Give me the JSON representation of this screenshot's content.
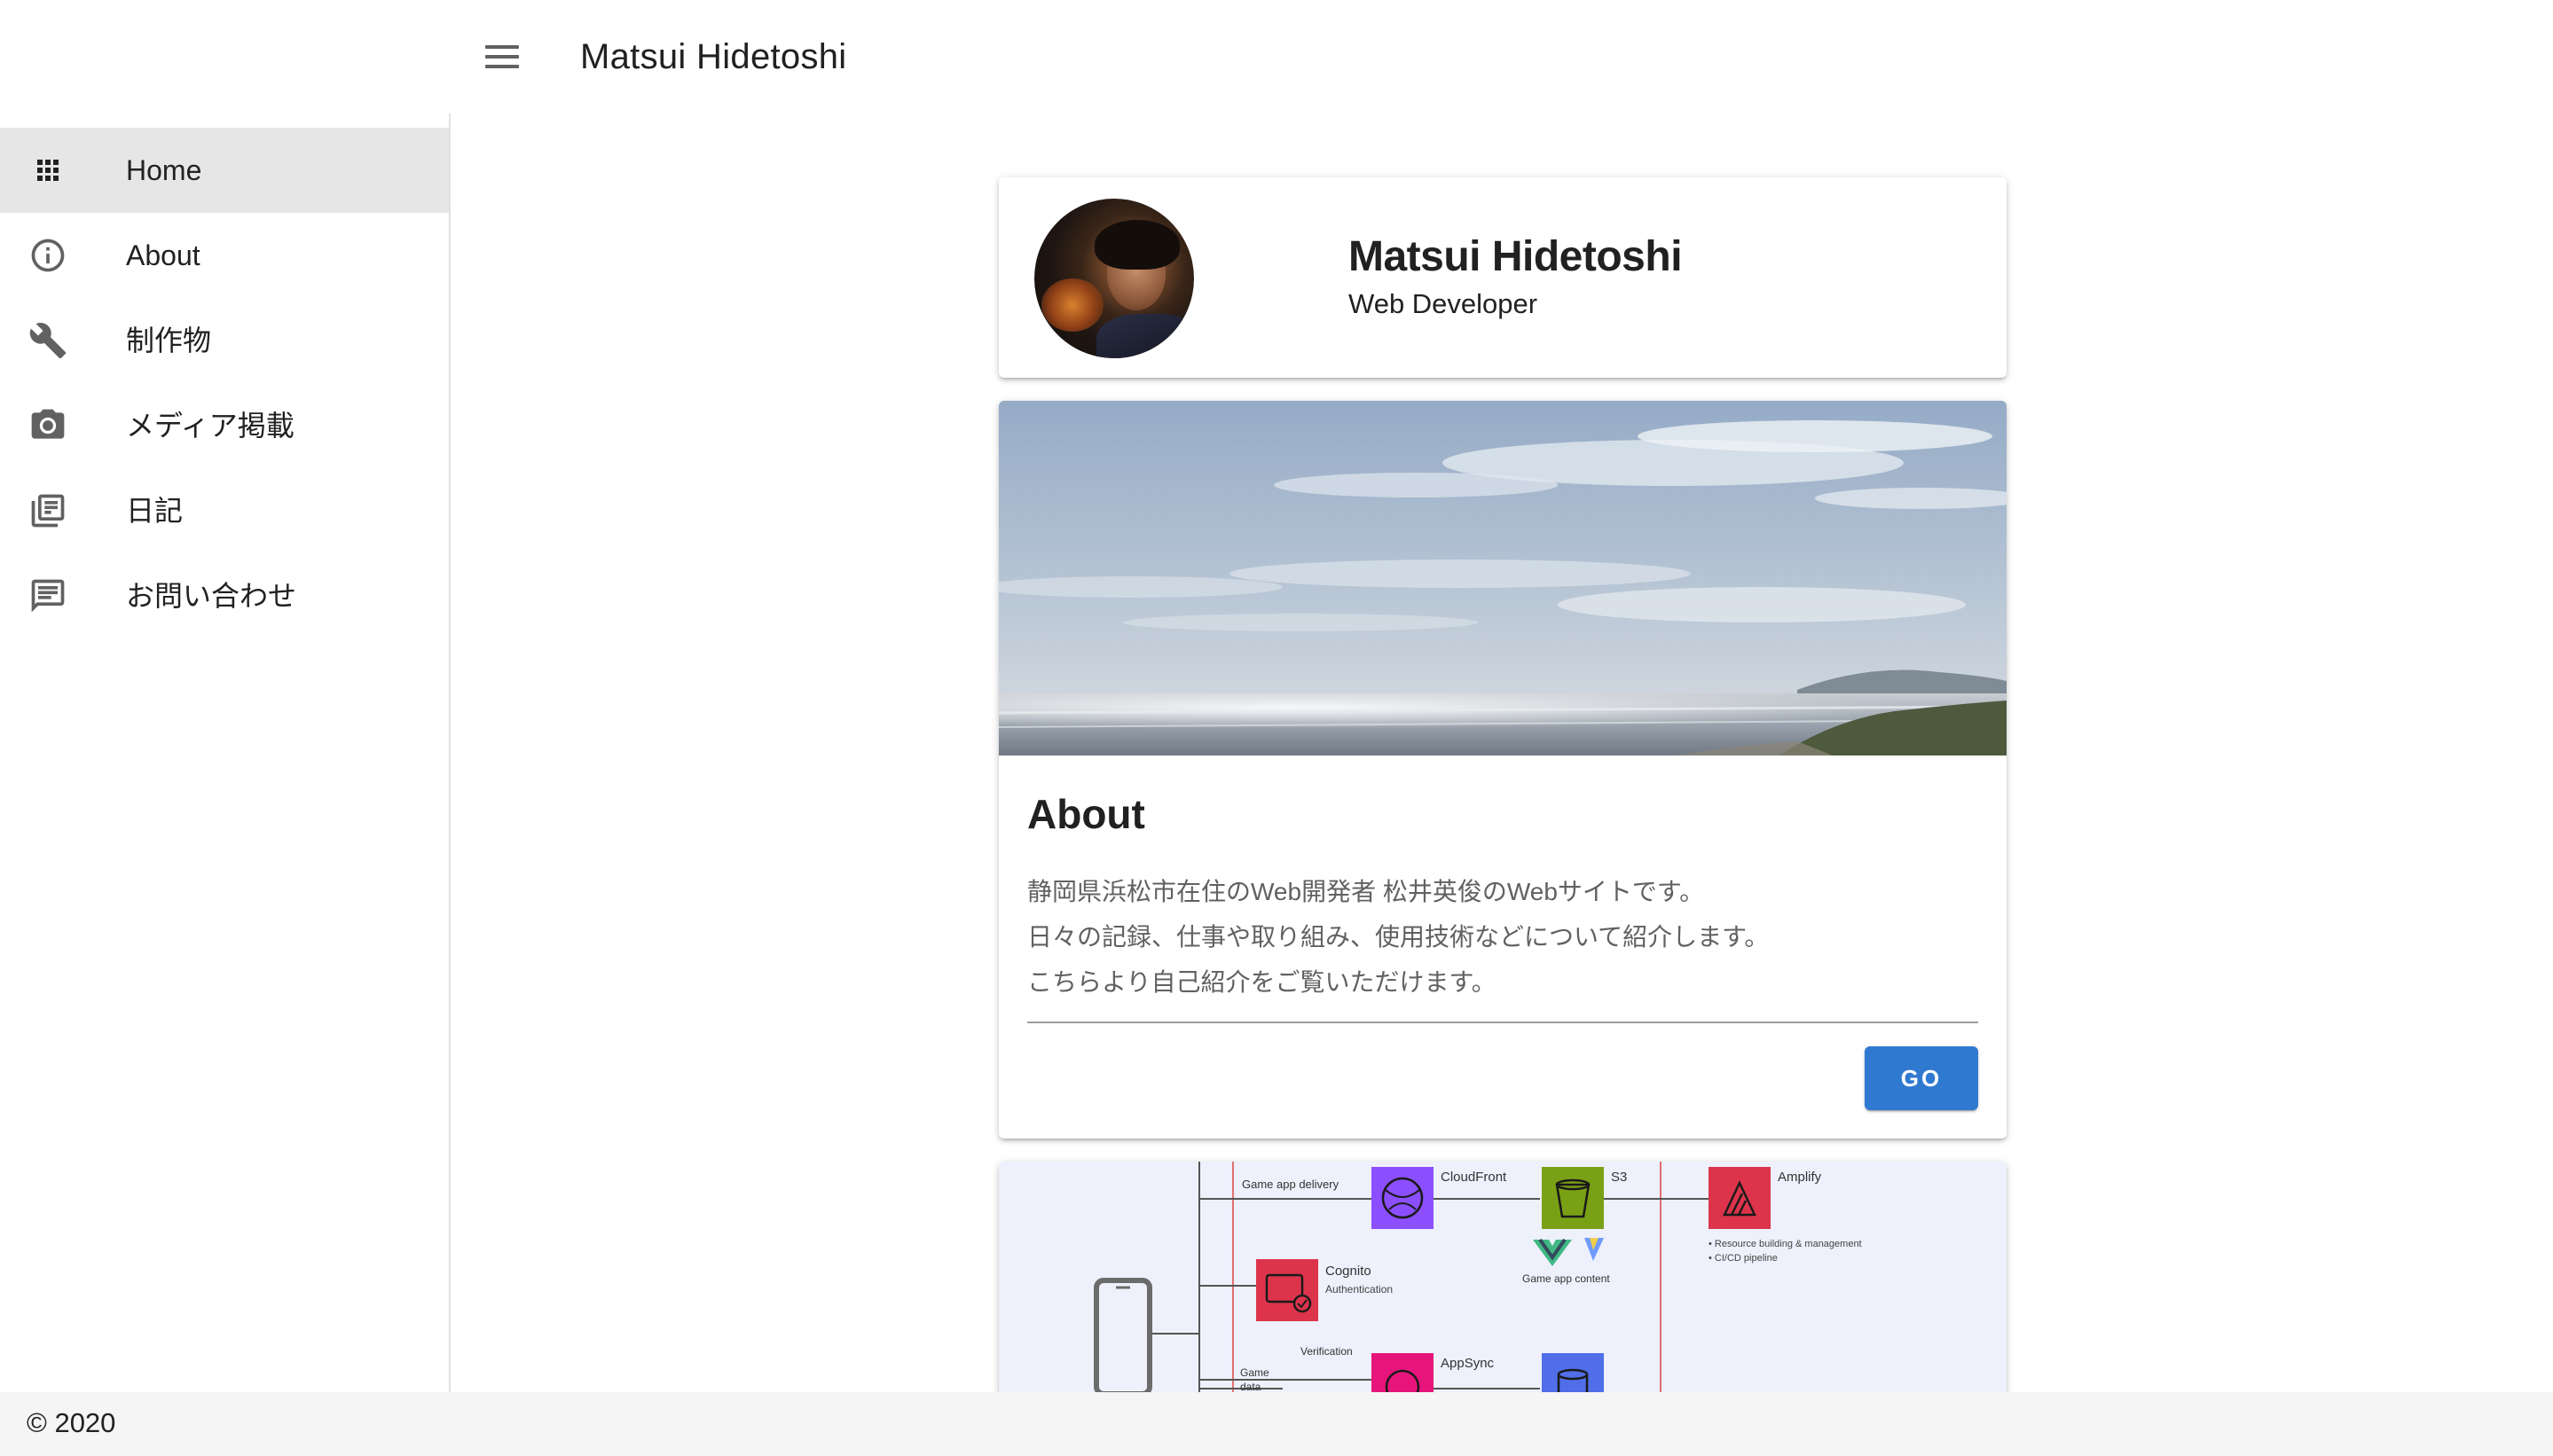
{
  "appbar": {
    "title": "Matsui Hidetoshi",
    "menu_icon": "menu-icon"
  },
  "sidebar": {
    "items": [
      {
        "label": "Home",
        "icon": "apps-grid-icon",
        "active": true
      },
      {
        "label": "About",
        "icon": "info-icon",
        "active": false
      },
      {
        "label": "制作物",
        "icon": "wrench-icon",
        "active": false
      },
      {
        "label": "メディア掲載",
        "icon": "camera-icon",
        "active": false
      },
      {
        "label": "日記",
        "icon": "newspaper-icon",
        "active": false
      },
      {
        "label": "お問い合わせ",
        "icon": "feedback-icon",
        "active": false
      }
    ]
  },
  "profile": {
    "name": "Matsui Hidetoshi",
    "role": "Web Developer"
  },
  "about": {
    "title": "About",
    "lines": [
      "静岡県浜松市在住のWeb開発者 松井英俊のWebサイトです。",
      "日々の記録、仕事や取り組み、使用技術などについて紹介します。",
      "こちらより自己紹介をご覧いただけます。"
    ],
    "button_label": "GO",
    "accent_color": "#3079d1"
  },
  "diagram": {
    "labels": {
      "delivery": "Game app delivery",
      "cloudfront": "CloudFront",
      "s3": "S3",
      "content": "Game app content",
      "amplify": "Amplify",
      "amplify_note_1": "• Resource building & management",
      "amplify_note_2": "• CI/CD pipeline",
      "cognito": "Cognito",
      "cognito_sub": "Authentication",
      "verification": "Verification",
      "appsync": "AppSync",
      "game_data_1": "Game",
      "game_data_2": "data"
    }
  },
  "footer": {
    "text": "© 2020"
  }
}
